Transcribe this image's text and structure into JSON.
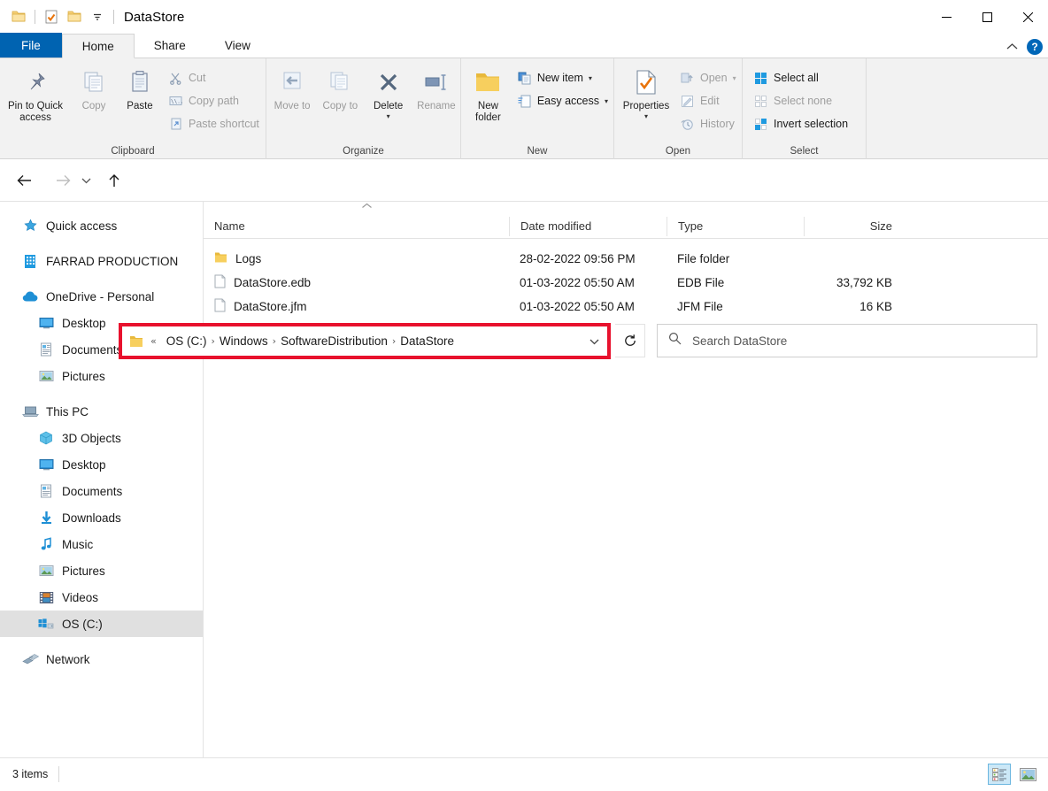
{
  "window": {
    "title": "DataStore",
    "quick_access": [
      {
        "name": "folder-icon",
        "label": "Folder"
      },
      {
        "name": "properties-icon",
        "label": "Properties"
      },
      {
        "name": "new-folder-icon",
        "label": "New folder"
      },
      {
        "name": "customize-dropdown-icon",
        "label": "Customize Quick Access Toolbar"
      }
    ],
    "controls": {
      "minimize": "—",
      "maximize": "☐",
      "close": "✕"
    }
  },
  "tabs": [
    {
      "label": "File",
      "id": "file"
    },
    {
      "label": "Home",
      "id": "home"
    },
    {
      "label": "Share",
      "id": "share"
    },
    {
      "label": "View",
      "id": "view"
    }
  ],
  "ribbon": {
    "collapse_icon": "chevron-up-icon",
    "help_label": "?",
    "groups": [
      {
        "label": "Clipboard",
        "big": [
          {
            "label": "Pin to Quick access",
            "icon": "pin-icon",
            "dim": false
          },
          {
            "label": "Copy",
            "icon": "copy-icon",
            "dim": true
          },
          {
            "label": "Paste",
            "icon": "paste-icon",
            "dim": false
          }
        ],
        "small": [
          {
            "label": "Cut",
            "icon": "scissors-icon",
            "dim": true
          },
          {
            "label": "Copy path",
            "icon": "copy-path-icon",
            "dim": true
          },
          {
            "label": "Paste shortcut",
            "icon": "paste-shortcut-icon",
            "dim": true
          }
        ]
      },
      {
        "label": "Organize",
        "big": [
          {
            "label": "Move to",
            "icon": "move-to-icon",
            "dim": true,
            "caret": true
          },
          {
            "label": "Copy to",
            "icon": "copy-to-icon",
            "dim": true,
            "caret": true
          },
          {
            "label": "Delete",
            "icon": "delete-icon",
            "dim": false,
            "caret": true
          },
          {
            "label": "Rename",
            "icon": "rename-icon",
            "dim": true
          }
        ],
        "small": []
      },
      {
        "label": "New",
        "big": [
          {
            "label": "New folder",
            "icon": "new-folder-icon",
            "dim": false
          }
        ],
        "small": [
          {
            "label": "New item",
            "icon": "new-item-icon",
            "dim": false,
            "caret": true
          },
          {
            "label": "Easy access",
            "icon": "easy-access-icon",
            "dim": false,
            "caret": true
          }
        ]
      },
      {
        "label": "Open",
        "big": [
          {
            "label": "Properties",
            "icon": "properties-icon",
            "dim": false,
            "caret": true
          }
        ],
        "small": [
          {
            "label": "Open",
            "icon": "open-icon",
            "dim": true,
            "caret": true
          },
          {
            "label": "Edit",
            "icon": "edit-icon",
            "dim": true
          },
          {
            "label": "History",
            "icon": "history-icon",
            "dim": true
          }
        ]
      },
      {
        "label": "Select",
        "big": [],
        "small": [
          {
            "label": "Select all",
            "icon": "select-all-icon",
            "dim": false
          },
          {
            "label": "Select none",
            "icon": "select-none-icon",
            "dim": true
          },
          {
            "label": "Invert selection",
            "icon": "invert-selection-icon",
            "dim": false
          }
        ]
      }
    ]
  },
  "addressbar": {
    "back_icon": "arrow-left-icon",
    "forward_icon": "arrow-right-icon",
    "recent_icon": "chevron-down-icon",
    "up_icon": "arrow-up-icon",
    "folder_icon": "folder-icon",
    "overflow": "«",
    "crumbs": [
      "OS (C:)",
      "Windows",
      "SoftwareDistribution",
      "DataStore"
    ],
    "separator": "›",
    "dropdown_icon": "chevron-down-icon",
    "refresh_icon": "refresh-icon",
    "highlight_color": "#e8112d"
  },
  "search": {
    "icon": "search-icon",
    "placeholder": "Search DataStore"
  },
  "sidebar": {
    "items": [
      {
        "label": "Quick access",
        "icon": "star-pin-icon",
        "indent": 0,
        "selected": false,
        "gap_after": true
      },
      {
        "label": "FARRAD PRODUCTION",
        "icon": "building-icon",
        "indent": 0,
        "selected": false,
        "gap_after": true
      },
      {
        "label": "OneDrive - Personal",
        "icon": "cloud-icon",
        "indent": 0,
        "selected": false,
        "gap_after": false
      },
      {
        "label": "Desktop",
        "icon": "desktop-icon",
        "indent": 1,
        "selected": false,
        "gap_after": false
      },
      {
        "label": "Documents",
        "icon": "documents-icon",
        "indent": 1,
        "selected": false,
        "gap_after": false
      },
      {
        "label": "Pictures",
        "icon": "pictures-icon",
        "indent": 1,
        "selected": false,
        "gap_after": true
      },
      {
        "label": "This PC",
        "icon": "pc-icon",
        "indent": 0,
        "selected": false,
        "gap_after": false
      },
      {
        "label": "3D Objects",
        "icon": "3d-objects-icon",
        "indent": 1,
        "selected": false,
        "gap_after": false
      },
      {
        "label": "Desktop",
        "icon": "desktop-icon",
        "indent": 1,
        "selected": false,
        "gap_after": false
      },
      {
        "label": "Documents",
        "icon": "documents-icon",
        "indent": 1,
        "selected": false,
        "gap_after": false
      },
      {
        "label": "Downloads",
        "icon": "downloads-icon",
        "indent": 1,
        "selected": false,
        "gap_after": false
      },
      {
        "label": "Music",
        "icon": "music-icon",
        "indent": 1,
        "selected": false,
        "gap_after": false
      },
      {
        "label": "Pictures",
        "icon": "pictures-icon",
        "indent": 1,
        "selected": false,
        "gap_after": false
      },
      {
        "label": "Videos",
        "icon": "videos-icon",
        "indent": 1,
        "selected": false,
        "gap_after": false
      },
      {
        "label": "OS (C:)",
        "icon": "drive-windows-icon",
        "indent": 1,
        "selected": true,
        "gap_after": true
      },
      {
        "label": "Network",
        "icon": "network-icon",
        "indent": 0,
        "selected": false,
        "gap_after": false
      }
    ]
  },
  "filelist": {
    "sort_indicator": "chevron-up-icon",
    "columns": [
      "Name",
      "Date modified",
      "Type",
      "Size"
    ],
    "rows": [
      {
        "name": "Logs",
        "date": "28-02-2022 09:56 PM",
        "type": "File folder",
        "size": "",
        "icon": "folder-icon"
      },
      {
        "name": "DataStore.edb",
        "date": "01-03-2022 05:50 AM",
        "type": "EDB File",
        "size": "33,792 KB",
        "icon": "file-icon"
      },
      {
        "name": "DataStore.jfm",
        "date": "01-03-2022 05:50 AM",
        "type": "JFM File",
        "size": "16 KB",
        "icon": "file-icon"
      }
    ]
  },
  "statusbar": {
    "item_count": "3 items",
    "views": [
      {
        "name": "details-view-button",
        "active": true
      },
      {
        "name": "large-icons-view-button",
        "active": false
      }
    ]
  }
}
